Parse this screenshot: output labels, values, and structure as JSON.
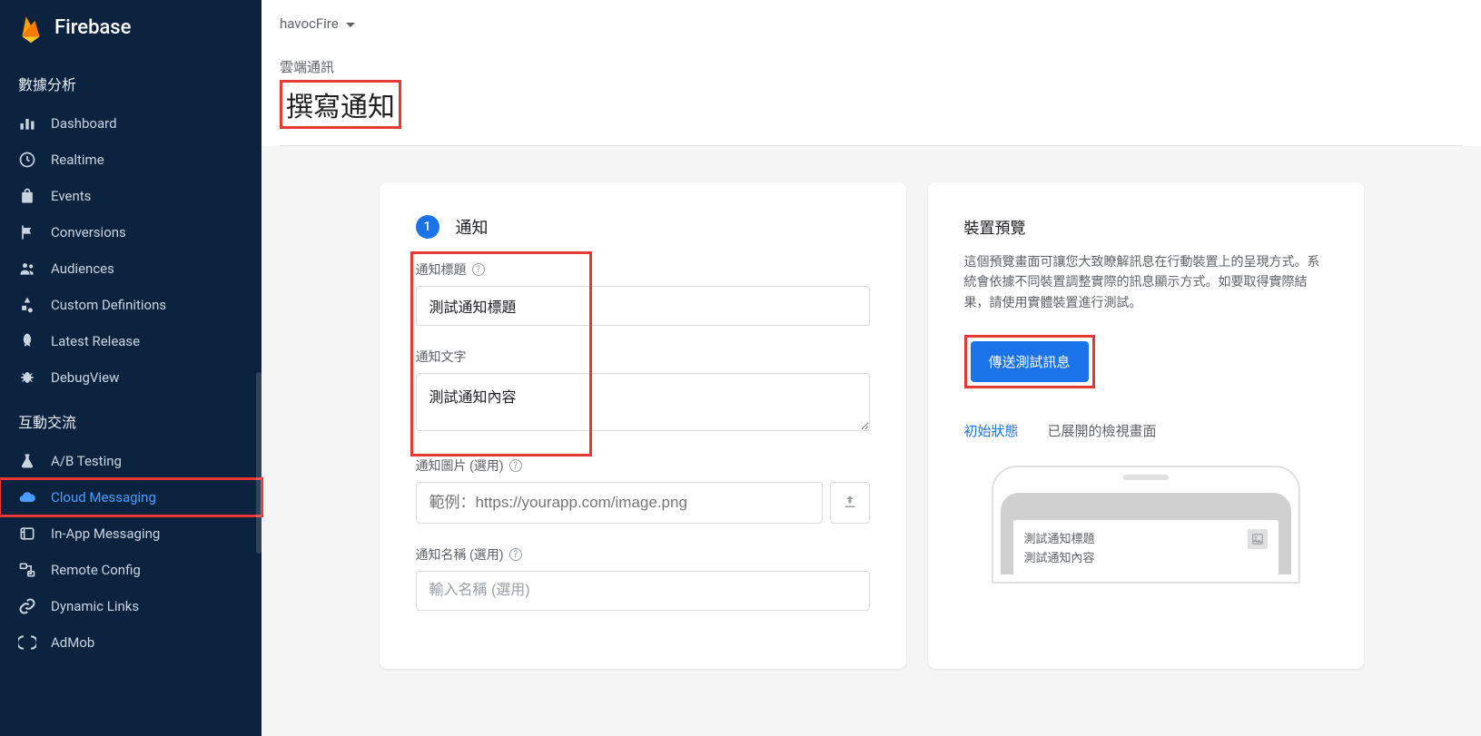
{
  "brand": "Firebase",
  "project": "havocFire",
  "sidebar": {
    "section1": "數據分析",
    "section2": "互動交流",
    "items1": [
      {
        "label": "Dashboard"
      },
      {
        "label": "Realtime"
      },
      {
        "label": "Events"
      },
      {
        "label": "Conversions"
      },
      {
        "label": "Audiences"
      },
      {
        "label": "Custom Definitions"
      },
      {
        "label": "Latest Release"
      },
      {
        "label": "DebugView"
      }
    ],
    "items2": [
      {
        "label": "A/B Testing"
      },
      {
        "label": "Cloud Messaging"
      },
      {
        "label": "In-App Messaging"
      },
      {
        "label": "Remote Config"
      },
      {
        "label": "Dynamic Links"
      },
      {
        "label": "AdMob"
      }
    ]
  },
  "breadcrumb": "雲端通訊",
  "page_title": "撰寫通知",
  "step": {
    "num": "1",
    "title": "通知"
  },
  "fields": {
    "title_label": "通知標題",
    "title_value": "測試通知標題",
    "body_label": "通知文字",
    "body_value": "測試通知內容",
    "image_label": "通知圖片 (選用)",
    "image_placeholder": "範例：https://yourapp.com/image.png",
    "name_label": "通知名稱 (選用)",
    "name_placeholder": "輸入名稱 (選用)"
  },
  "preview": {
    "title": "裝置預覽",
    "desc": "這個預覽畫面可讓您大致瞭解訊息在行動裝置上的呈現方式。系統會依據不同裝置調整實際的訊息顯示方式。如要取得實際結果，請使用實體裝置進行測試。",
    "send_btn": "傳送測試訊息",
    "tab1": "初始狀態",
    "tab2": "已展開的檢視畫面",
    "notif_title": "測試通知標題",
    "notif_body": "測試通知內容"
  }
}
